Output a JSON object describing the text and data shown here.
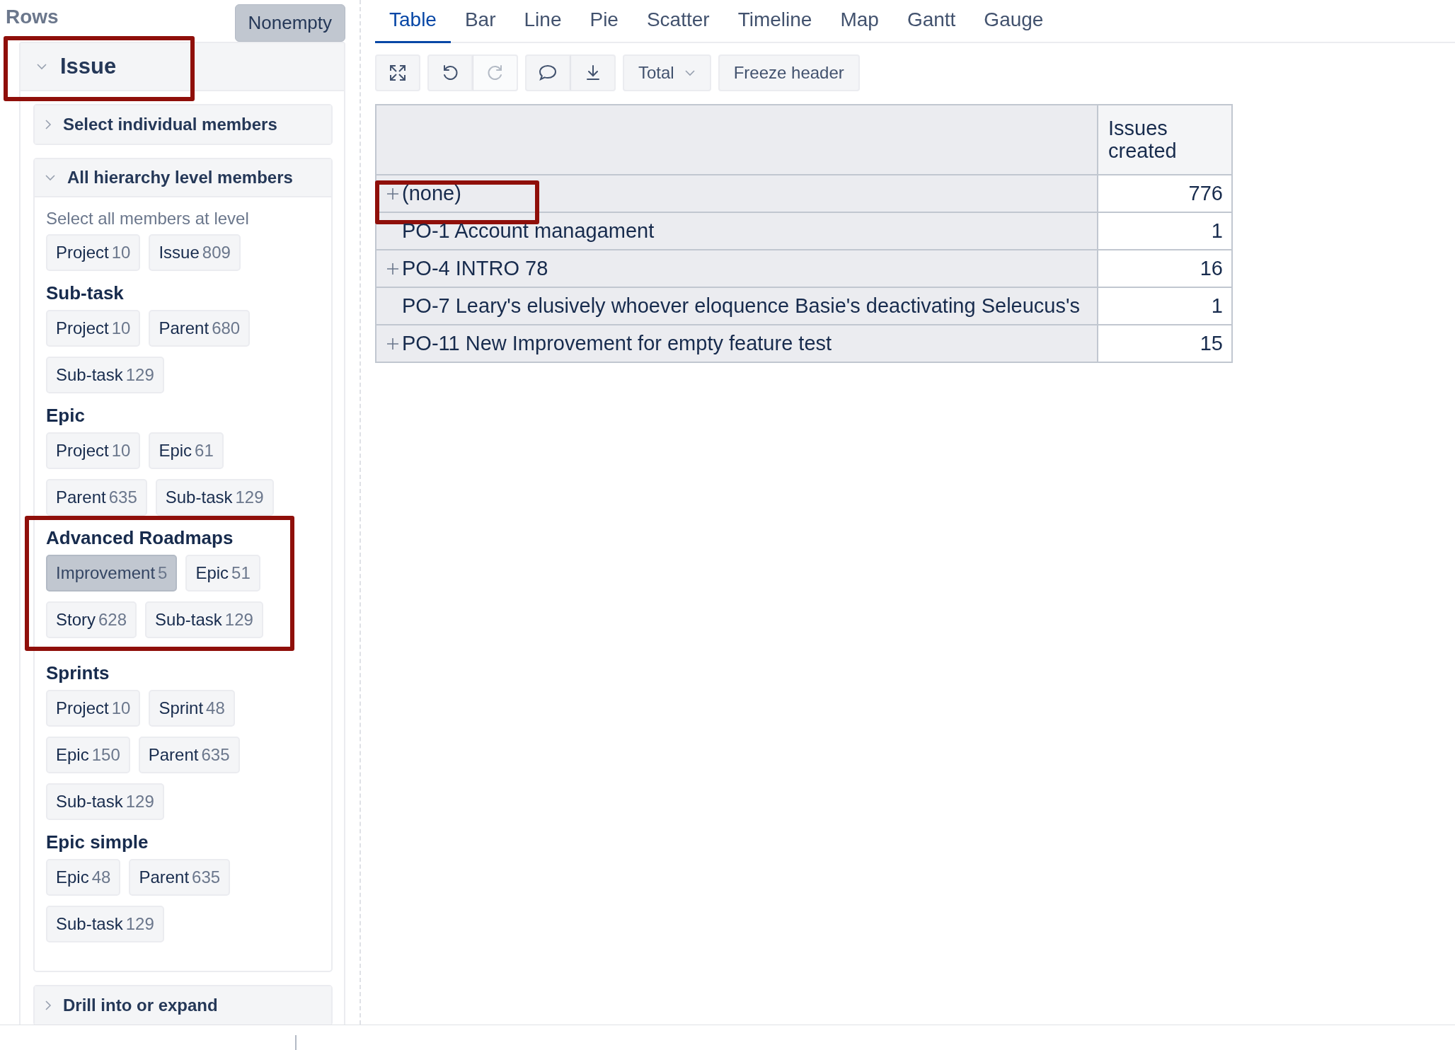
{
  "sidebar": {
    "title": "Rows",
    "nonempty_button": {
      "label": "Nonempty",
      "selected": true
    },
    "dimension": {
      "label": "Issue",
      "expanded": true,
      "highlighted": true
    },
    "sections": [
      {
        "label": "Select individual members",
        "expanded": false
      },
      {
        "label": "All hierarchy level members",
        "expanded": true,
        "hint": "Select all members at level",
        "groups": [
          {
            "chips": [
              {
                "label": "Project",
                "count": "10",
                "selected": false
              },
              {
                "label": "Issue",
                "count": "809",
                "selected": false
              }
            ],
            "highlighted": false
          },
          {
            "title": "Sub-task",
            "chips": [
              {
                "label": "Project",
                "count": "10",
                "selected": false
              },
              {
                "label": "Parent",
                "count": "680",
                "selected": false
              },
              {
                "label": "Sub-task",
                "count": "129",
                "selected": false
              }
            ],
            "highlighted": false
          },
          {
            "title": "Epic",
            "chips": [
              {
                "label": "Project",
                "count": "10",
                "selected": false
              },
              {
                "label": "Epic",
                "count": "61",
                "selected": false
              },
              {
                "label": "Parent",
                "count": "635",
                "selected": false
              },
              {
                "label": "Sub-task",
                "count": "129",
                "selected": false
              }
            ],
            "highlighted": false
          },
          {
            "title": "Advanced Roadmaps",
            "chips": [
              {
                "label": "Improvement",
                "count": "5",
                "selected": true
              },
              {
                "label": "Epic",
                "count": "51",
                "selected": false
              },
              {
                "label": "Story",
                "count": "628",
                "selected": false
              },
              {
                "label": "Sub-task",
                "count": "129",
                "selected": false
              }
            ],
            "highlighted": true
          },
          {
            "title": "Sprints",
            "chips": [
              {
                "label": "Project",
                "count": "10",
                "selected": false
              },
              {
                "label": "Sprint",
                "count": "48",
                "selected": false
              },
              {
                "label": "Epic",
                "count": "150",
                "selected": false
              },
              {
                "label": "Parent",
                "count": "635",
                "selected": false
              },
              {
                "label": "Sub-task",
                "count": "129",
                "selected": false
              }
            ],
            "highlighted": false
          },
          {
            "title": "Epic simple",
            "chips": [
              {
                "label": "Epic",
                "count": "48",
                "selected": false
              },
              {
                "label": "Parent",
                "count": "635",
                "selected": false
              },
              {
                "label": "Sub-task",
                "count": "129",
                "selected": false
              }
            ],
            "highlighted": false
          }
        ]
      },
      {
        "label": "Drill into or expand",
        "expanded": false
      }
    ]
  },
  "tabs": [
    {
      "label": "Table",
      "selected": true
    },
    {
      "label": "Bar",
      "selected": false
    },
    {
      "label": "Line",
      "selected": false
    },
    {
      "label": "Pie",
      "selected": false
    },
    {
      "label": "Scatter",
      "selected": false
    },
    {
      "label": "Timeline",
      "selected": false
    },
    {
      "label": "Map",
      "selected": false
    },
    {
      "label": "Gantt",
      "selected": false
    },
    {
      "label": "Gauge",
      "selected": false
    }
  ],
  "toolbar": {
    "groups": [
      [
        {
          "kind": "expand",
          "disabled": false
        }
      ],
      [
        {
          "kind": "undo",
          "disabled": false
        },
        {
          "kind": "redo",
          "disabled": true
        }
      ],
      [
        {
          "kind": "comment",
          "disabled": false
        },
        {
          "kind": "download",
          "disabled": false
        }
      ]
    ],
    "total_dropdown": "Total",
    "freeze_button": "Freeze header"
  },
  "table": {
    "columns": [
      "Issues created"
    ],
    "rows": [
      {
        "label": "(none)",
        "expandable": true,
        "value": "776",
        "highlighted": true
      },
      {
        "label": "PO-1 Account managament",
        "expandable": false,
        "value": "1",
        "highlighted": false
      },
      {
        "label": "PO-4 INTRO 78",
        "expandable": true,
        "value": "16",
        "highlighted": false
      },
      {
        "label": "PO-7 Leary's elusively whoever eloquence Basie's deactivating Seleucus's",
        "expandable": false,
        "value": "1",
        "highlighted": false
      },
      {
        "label": "PO-11 New Improvement for empty feature test",
        "expandable": true,
        "value": "15",
        "highlighted": false
      }
    ]
  }
}
